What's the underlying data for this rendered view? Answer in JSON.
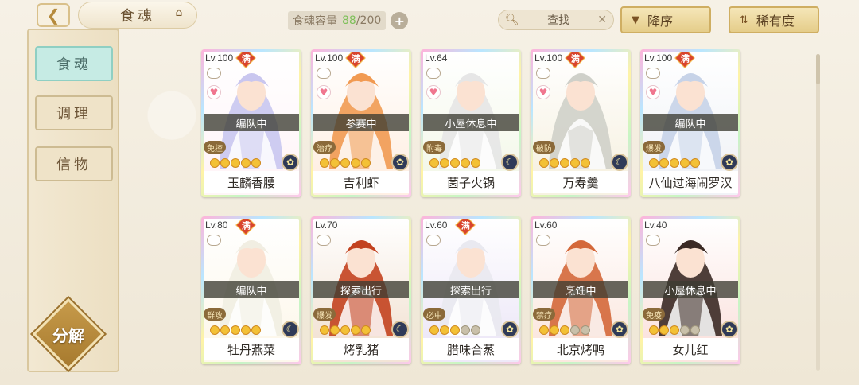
{
  "header": {
    "title": "食魂",
    "back_icon": "back-arrow-icon",
    "hat_icon": "chef-hat-icon",
    "capacity_label": "食魂容量",
    "capacity_used": "88",
    "capacity_total": "/200",
    "capacity_add": "+",
    "search_label": "查找",
    "search_clear": "✕",
    "sort_desc_label": "降序",
    "sort_rarity_label": "稀有度"
  },
  "sidebar": {
    "tabs": [
      {
        "label": "食魂",
        "active": true
      },
      {
        "label": "调理",
        "active": false
      },
      {
        "label": "信物",
        "active": false
      }
    ],
    "decompose_label": "分解"
  },
  "cards": [
    {
      "level": "Lv.100",
      "max": "满",
      "status": "编队中",
      "role": "免控",
      "stars": 5,
      "name": "玉麟香腰",
      "elem_icon": "flower-icon",
      "hair": "#c9c6ef",
      "tone": "#fff5f8"
    },
    {
      "level": "Lv.100",
      "max": "满",
      "status": "参赛中",
      "role": "治疗",
      "stars": 5,
      "name": "吉利虾",
      "elem_icon": "flower-icon",
      "hair": "#f19a52",
      "tone": "#fff0e4"
    },
    {
      "level": "Lv.64",
      "max": "",
      "status": "小屋休息中",
      "role": "附毒",
      "stars": 5,
      "name": "菌子火锅",
      "elem_icon": "moon-icon",
      "hair": "#e6e6e6",
      "tone": "#f4f8ea"
    },
    {
      "level": "Lv.100",
      "max": "满",
      "status": "",
      "role": "破防",
      "stars": 5,
      "name": "万寿羹",
      "elem_icon": "moon-icon",
      "hair": "#cfd0c9",
      "tone": "#f7f2e3"
    },
    {
      "level": "Lv.100",
      "max": "满",
      "status": "编队中",
      "role": "爆发",
      "stars": 5,
      "name": "八仙过海闹罗汉",
      "elem_icon": "flower-icon",
      "hair": "#c7d3e8",
      "tone": "#f1f3f7"
    },
    {
      "level": "Lv.80",
      "max": "满",
      "status": "编队中",
      "role": "群攻",
      "stars": 5,
      "name": "牡丹燕菜",
      "elem_icon": "moon-icon",
      "hair": "#f1eee2",
      "tone": "#fdf8ec"
    },
    {
      "level": "Lv.70",
      "max": "",
      "status": "探索出行",
      "role": "爆发",
      "stars": 5,
      "name": "烤乳猪",
      "elem_icon": "moon-icon",
      "hair": "#c3421f",
      "tone": "#f3e4d6"
    },
    {
      "level": "Lv.60",
      "max": "满",
      "status": "探索出行",
      "role": "必中",
      "stars": 3,
      "name": "腊味合蒸",
      "elem_icon": "flower-icon",
      "hair": "#e9e9f0",
      "tone": "#eee9f8"
    },
    {
      "level": "Lv.60",
      "max": "",
      "status": "烹饪中",
      "role": "禁疗",
      "stars": 3,
      "name": "北京烤鸭",
      "elem_icon": "flower-icon",
      "hair": "#d4683a",
      "tone": "#fbe8e0"
    },
    {
      "level": "Lv.40",
      "max": "",
      "status": "小屋休息中",
      "role": "免疫",
      "stars": 3,
      "name": "女儿红",
      "elem_icon": "flower-icon",
      "hair": "#3b2a25",
      "tone": "#fbe4e0"
    }
  ]
}
